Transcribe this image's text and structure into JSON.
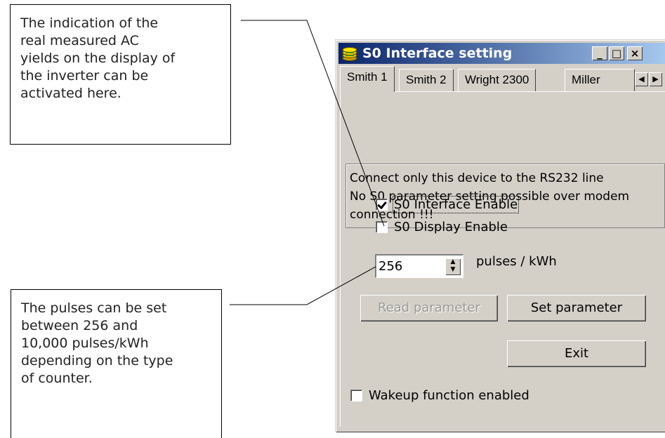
{
  "callouts": {
    "top": "The indication of the\nreal measured AC\nyields on the display of\nthe inverter can be\nactivated here.",
    "bottom": "The pulses can be set\nbetween 256 and\n10,000 pulses/kWh\ndepending on the type\nof counter."
  },
  "window": {
    "title": "S0 Interface setting",
    "minimize": "_",
    "maximize": "□",
    "close": "×"
  },
  "tabs": [
    {
      "label": "Smith 1"
    },
    {
      "label": "Smith 2"
    },
    {
      "label": "Wright  2300"
    },
    {
      "label": "Miller"
    }
  ],
  "notice": "Connect only this device  to the RS232 line\nNo S0 parameter setting  possible over modem\nconnection !!!",
  "options": {
    "s0_interface_enable": {
      "label": "S0 Interface Enable",
      "checked": true
    },
    "s0_display_enable": {
      "label": "S0 Display Enable",
      "checked": false
    },
    "wakeup": {
      "label": "Wakeup function enabled",
      "checked": false
    }
  },
  "pulses": {
    "value": "256",
    "unit_label": "pulses / kWh"
  },
  "buttons": {
    "read": "Read parameter",
    "set": "Set parameter",
    "exit": "Exit"
  },
  "colors": {
    "titlebar_start": "#0a246a",
    "titlebar_end": "#a6caf0",
    "face": "#d4d0c8"
  }
}
